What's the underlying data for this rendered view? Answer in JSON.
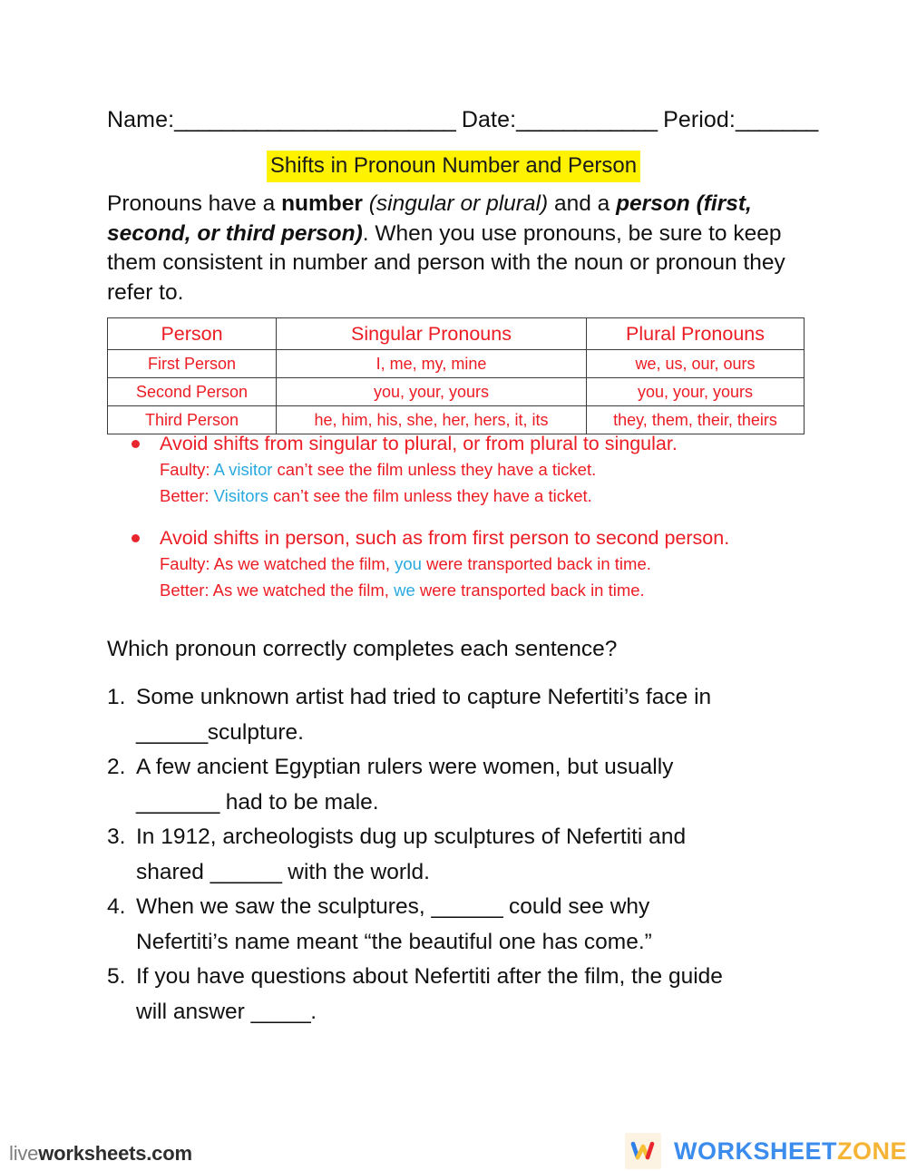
{
  "header": {
    "name_label": "Name:",
    "name_rule": "________________________",
    "date_label": "Date:",
    "date_rule": "____________",
    "period_label": "Period:",
    "period_rule": "_______"
  },
  "title": "Shifts in Pronoun Number and Person",
  "intro": {
    "p1": "Pronouns have a ",
    "bold1": "number",
    "italic1": " (singular or plural)",
    "p2": " and a ",
    "bolditalic1": "person (first, second, or third person)",
    "p3": ". When you use pronouns, be sure to keep them consistent in number and person with the noun or pronoun they refer to."
  },
  "table": {
    "headers": [
      "Person",
      "Singular Pronouns",
      "Plural Pronouns"
    ],
    "rows": [
      [
        "First Person",
        "I, me, my, mine",
        "we, us, our, ours"
      ],
      [
        "Second Person",
        "you, your, yours",
        "you, your, yours"
      ],
      [
        "Third Person",
        "he, him, his, she, her, hers, it, its",
        "they, them, their, theirs"
      ]
    ]
  },
  "rules": [
    {
      "heading": "Avoid shifts from singular to plural, or from plural to singular.",
      "faulty_label": "Faulty: ",
      "faulty_highlight": "A visitor",
      "faulty_rest": " can’t see the film unless they have a ticket.",
      "better_label": "Better: ",
      "better_highlight": "Visitors",
      "better_rest": " can’t see the film unless they have a ticket."
    },
    {
      "heading": "Avoid shifts in person, such as from first person to second person.",
      "faulty_label": "Faulty: As we watched the film, ",
      "faulty_highlight": "you",
      "faulty_rest": " were transported back in time.",
      "better_label": "Better: As we watched the film, ",
      "better_highlight": "we",
      "better_rest": " were transported back in time."
    }
  ],
  "prompt": "Which pronoun correctly completes each sentence?",
  "questions": [
    {
      "number": "1.",
      "line1": "Some unknown artist had tried to capture Nefertiti’s face in",
      "line2_pre": "",
      "line2_blank": "______",
      "line2_post": "sculpture."
    },
    {
      "number": "2.",
      "line1": "A few ancient Egyptian rulers were women, but usually",
      "line2_pre": "",
      "line2_blank": "_______",
      "line2_post": " had to be male."
    },
    {
      "number": "3.",
      "line1": "In 1912, archeologists dug up sculptures of Nefertiti and",
      "line2_pre": "shared ",
      "line2_blank": "______",
      "line2_post": " with the world."
    },
    {
      "number": "4.",
      "line1_pre": "When we saw the sculptures, ",
      "line1_blank": "______",
      "line1_post": " could see why",
      "line2": "Nefertiti’s name meant “the beautiful one has come.”"
    },
    {
      "number": "5.",
      "line1": "If you have questions about Nefertiti after the film, the guide",
      "line2_pre": "will answer ",
      "line2_blank": "_____",
      "line2_post": "."
    }
  ],
  "footer": {
    "liveworksheets_light": "live",
    "liveworksheets_bold": "worksheets.com",
    "worksheetzone_a": "WORKSHEET",
    "worksheetzone_b": "ZONE"
  },
  "colors": {
    "red": "#ec1c24",
    "blue_highlight": "#29a9e0",
    "title_highlight": "#fff200",
    "wz_blue": "#3b8ced",
    "wz_orange": "#f5b436"
  }
}
